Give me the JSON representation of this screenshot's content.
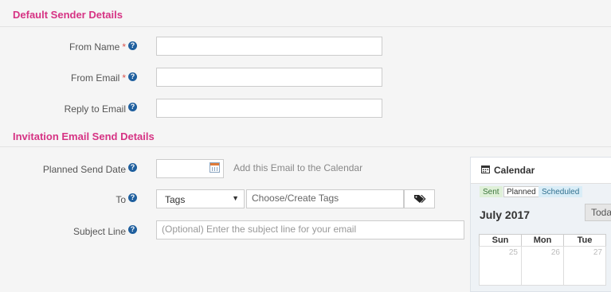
{
  "default_sender": {
    "title": "Default Sender Details",
    "from_name": {
      "label": "From Name",
      "required": "*",
      "value": ""
    },
    "from_email": {
      "label": "From Email",
      "required": "*",
      "value": ""
    },
    "reply_to": {
      "label": "Reply to Email",
      "value": ""
    }
  },
  "invitation": {
    "title": "Invitation Email Send Details",
    "planned_date": {
      "label": "Planned Send Date",
      "value": "",
      "calendar_link": "Add this Email to the Calendar"
    },
    "to": {
      "label": "To",
      "selected": "Tags",
      "caret": "▼",
      "tags_placeholder": "Choose/Create Tags",
      "tag_icon": "tags-icon"
    },
    "subject": {
      "label": "Subject Line",
      "placeholder": "(Optional) Enter the subject line for your email"
    }
  },
  "help_glyph": "?",
  "calendar": {
    "title": "Calendar",
    "icon": "calendar-icon",
    "legend": [
      "Sent",
      "Planned",
      "Scheduled"
    ],
    "month": "July 2017",
    "today_label": "Today",
    "weekdays": [
      "Sun",
      "Mon",
      "Tue"
    ],
    "first_row_days": [
      "25",
      "26",
      "27"
    ]
  },
  "colors": {
    "section_title": "#d63384",
    "help_icon": "#1f5f9e",
    "required": "#d9534f"
  }
}
